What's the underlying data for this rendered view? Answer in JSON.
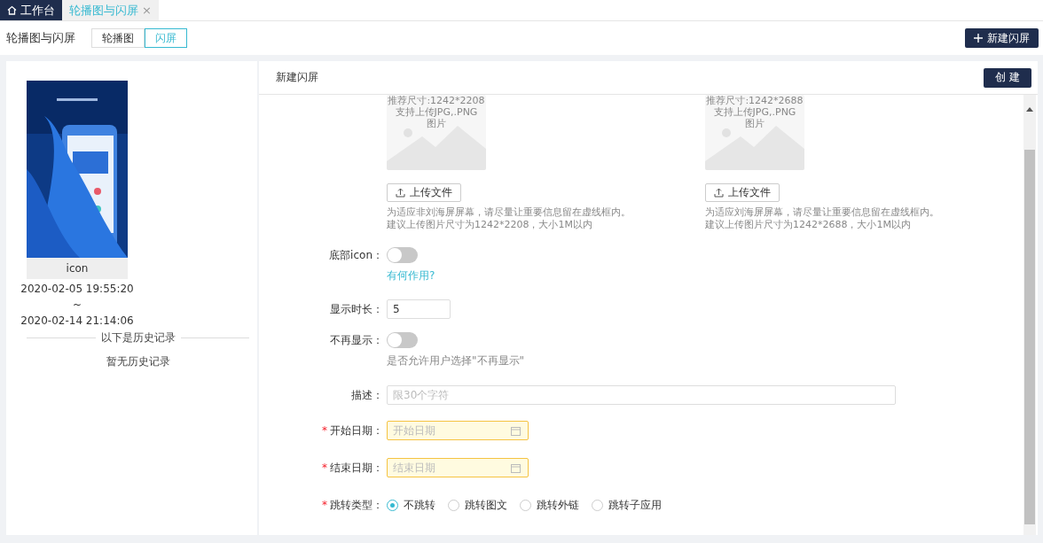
{
  "tabs": [
    {
      "label": "工作台",
      "kind": "home",
      "selected": false
    },
    {
      "label": "轮播图与闪屏",
      "kind": "page",
      "selected": true,
      "close": "×"
    }
  ],
  "toolbar": {
    "title": "轮播图与闪屏",
    "segments": [
      {
        "label": "轮播图",
        "selected": false
      },
      {
        "label": "闪屏",
        "selected": true
      }
    ],
    "new_button": "新建闪屏"
  },
  "current": {
    "caption": "icon",
    "start": "2020-02-05 19:55:20",
    "tilde": "~",
    "end": "2020-02-14 21:14:06"
  },
  "history": {
    "divider_label": "以下是历史记录",
    "empty": "暂无历史记录"
  },
  "form": {
    "title": "新建闪屏",
    "create_button": "创 建",
    "uploads": [
      {
        "size": "推荐尺寸:1242*2208",
        "formats": "支持上传JPG,.PNG",
        "placeholder": "图片",
        "button": "上传文件",
        "hints": [
          "为适应非刘海屏屏幕，请尽量让重要信息留在虚线框内。",
          "建议上传图片尺寸为1242*2208，大小1M以内"
        ]
      },
      {
        "size": "推荐尺寸:1242*2688",
        "formats": "支持上传JPG,.PNG",
        "placeholder": "图片",
        "button": "上传文件",
        "hints": [
          "为适应刘海屏屏幕，请尽量让重要信息留在虚线框内。",
          "建议上传图片尺寸为1242*2688，大小1M以内"
        ]
      }
    ],
    "fields": [
      {
        "kind": "switch",
        "label": "底部icon：",
        "on": false,
        "link": "有何作用?"
      },
      {
        "kind": "number",
        "label": "显示时长：",
        "value": "5"
      },
      {
        "kind": "switch",
        "label": "不再显示：",
        "on": false,
        "hint": "是否允许用户选择\"不再显示\""
      },
      {
        "kind": "text",
        "label": "描述：",
        "placeholder": "限30个字符"
      },
      {
        "kind": "date",
        "label": "开始日期：",
        "required_mark": "*",
        "placeholder": "开始日期"
      },
      {
        "kind": "date",
        "label": "结束日期：",
        "required_mark": "*",
        "placeholder": "结束日期"
      },
      {
        "kind": "radio",
        "label": "跳转类型：",
        "required_mark": "*",
        "options": [
          {
            "label": "不跳转",
            "selected": true
          },
          {
            "label": "跳转图文",
            "selected": false
          },
          {
            "label": "跳转外链",
            "selected": false
          },
          {
            "label": "跳转子应用",
            "selected": false
          }
        ]
      }
    ]
  }
}
